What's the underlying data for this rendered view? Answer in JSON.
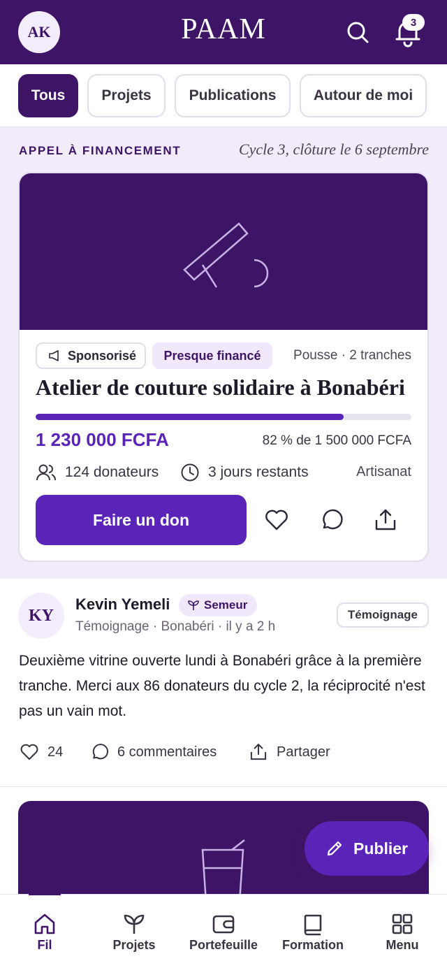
{
  "header": {
    "avatar_initials": "AK",
    "brand": "PAAM",
    "notification_count": "3"
  },
  "filters": [
    {
      "label": "Tous",
      "active": true
    },
    {
      "label": "Projets",
      "active": false
    },
    {
      "label": "Publications",
      "active": false
    },
    {
      "label": "Autour de moi",
      "active": false
    }
  ],
  "funding": {
    "section_label": "APPEL À FINANCEMENT",
    "cycle_note": "Cycle 3, clôture le 6 septembre",
    "card": {
      "sponsored_label": "Sponsorisé",
      "status_label": "Presque financé",
      "stage": "Pousse · 2 tranches",
      "title": "Atelier de couture solidaire à Bonabéri",
      "progress_percent": 82,
      "raised": "1 230 000 FCFA",
      "goal": "82 % de 1 500 000 FCFA",
      "donors": "124 donateurs",
      "days_left": "3 jours restants",
      "category": "Artisanat",
      "donate_label": "Faire un don"
    }
  },
  "post": {
    "avatar_initials": "KY",
    "author": "Kevin Yemeli",
    "rank": "Semeur",
    "meta": "Témoignage · Bonabéri · il y a 2 h",
    "tag": "Témoignage",
    "text": "Deuxième vitrine ouverte lundi à Bonabéri grâce à la première tranche. Merci aux 86 donateurs du cycle 2, la réciprocité n'est pas un vain mot.",
    "likes": "24",
    "comments": "6 commentaires",
    "share": "Partager"
  },
  "fab_label": "Publier",
  "nav": [
    {
      "label": "Fil",
      "icon": "home-icon",
      "active": true
    },
    {
      "label": "Projets",
      "icon": "sprout-icon",
      "active": false
    },
    {
      "label": "Portefeuille",
      "icon": "wallet-icon",
      "active": false
    },
    {
      "label": "Formation",
      "icon": "book-icon",
      "active": false
    },
    {
      "label": "Menu",
      "icon": "grid-icon",
      "active": false
    }
  ],
  "colors": {
    "primary_dark": "#3e1566",
    "primary": "#5b24b8",
    "tint": "#f1ebfa"
  }
}
